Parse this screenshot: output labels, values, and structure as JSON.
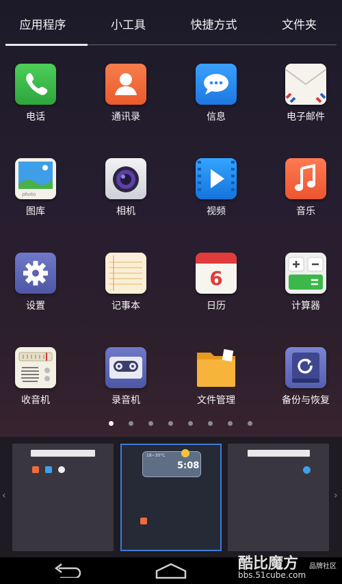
{
  "tabs": [
    "应用程序",
    "小工具",
    "快捷方式",
    "文件夹"
  ],
  "apps": [
    {
      "label": "电话",
      "icon": "phone-icon"
    },
    {
      "label": "通讯录",
      "icon": "contacts-icon"
    },
    {
      "label": "信息",
      "icon": "messages-icon"
    },
    {
      "label": "电子邮件",
      "icon": "email-icon"
    },
    {
      "label": "图库",
      "icon": "gallery-icon"
    },
    {
      "label": "相机",
      "icon": "camera-icon"
    },
    {
      "label": "视频",
      "icon": "video-icon"
    },
    {
      "label": "音乐",
      "icon": "music-icon"
    },
    {
      "label": "设置",
      "icon": "settings-icon"
    },
    {
      "label": "记事本",
      "icon": "notepad-icon"
    },
    {
      "label": "日历",
      "icon": "calendar-icon"
    },
    {
      "label": "计算器",
      "icon": "calculator-icon"
    },
    {
      "label": "收音机",
      "icon": "radio-icon"
    },
    {
      "label": "录音机",
      "icon": "recorder-icon"
    },
    {
      "label": "文件管理",
      "icon": "folder-icon"
    },
    {
      "label": "备份与恢复",
      "icon": "backup-icon"
    }
  ],
  "calendar_day": "6",
  "page_indicator": {
    "total": 8,
    "active": 0
  },
  "preview": {
    "clock_time": "5:08",
    "widget_temp": "18~30°C"
  },
  "watermark": {
    "brand": "酷比魔方",
    "sub": "品牌社区",
    "url": "bbs.51cube.com"
  },
  "colors": {
    "accent_blue": "#3d7bd8",
    "phone_green": "#3cb84a",
    "contacts_orange": "#f26c3a",
    "messages_blue": "#2a8ef0",
    "music_orange": "#f25f3a"
  }
}
